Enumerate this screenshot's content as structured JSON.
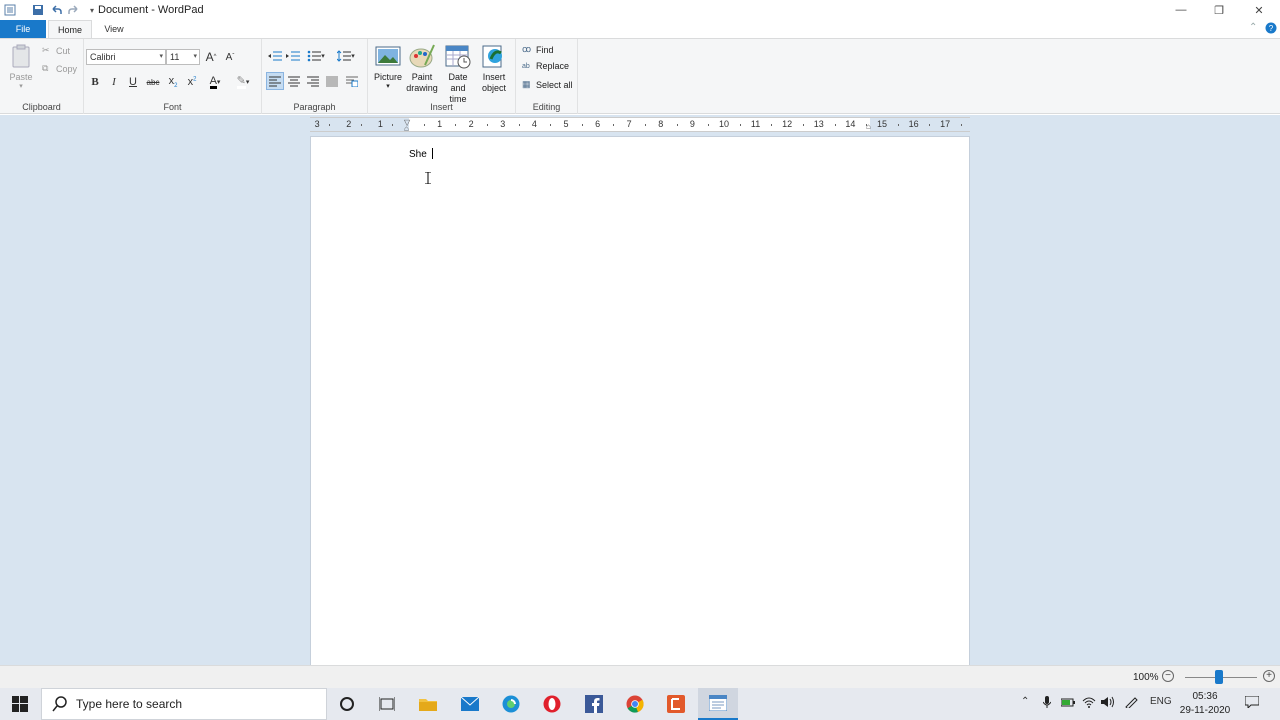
{
  "window": {
    "title": "Document - WordPad",
    "minimize": "—",
    "restore": "❐",
    "close": "✕"
  },
  "tabs": {
    "file": "File",
    "home": "Home",
    "view": "View"
  },
  "ribbon": {
    "clipboard": {
      "label": "Clipboard",
      "paste": "Paste",
      "cut": "Cut",
      "copy": "Copy"
    },
    "font": {
      "label": "Font",
      "family": "Calibri",
      "size": "11",
      "bold": "B",
      "italic": "I",
      "underline": "U",
      "strike": "abc",
      "grow": "A",
      "shrink": "A",
      "color_letter": "A"
    },
    "paragraph": {
      "label": "Paragraph"
    },
    "insert": {
      "label": "Insert",
      "picture": "Picture",
      "paint_1": "Paint",
      "paint_2": "drawing",
      "date_1": "Date and",
      "date_2": "time",
      "object_1": "Insert",
      "object_2": "object"
    },
    "editing": {
      "label": "Editing",
      "find": "Find",
      "replace": "Replace",
      "select_all": "Select all"
    }
  },
  "ruler": {
    "left_numbers": [
      "3",
      "2",
      "1"
    ],
    "numbers": [
      "1",
      "2",
      "3",
      "4",
      "5",
      "6",
      "7",
      "8",
      "9",
      "10",
      "11",
      "12",
      "13",
      "14",
      "15",
      "16",
      "17"
    ]
  },
  "document": {
    "text": "She "
  },
  "status": {
    "zoom": "100%",
    "zoom_minus": "−",
    "zoom_plus": "+"
  },
  "taskbar": {
    "search_placeholder": "Type here to search",
    "lang": "ENG",
    "time": "05:36",
    "date": "29-11-2020"
  },
  "colors": {
    "accent": "#1979ca",
    "workspace": "#d8e4f0",
    "ribbon_bg": "#f5f6f7"
  }
}
